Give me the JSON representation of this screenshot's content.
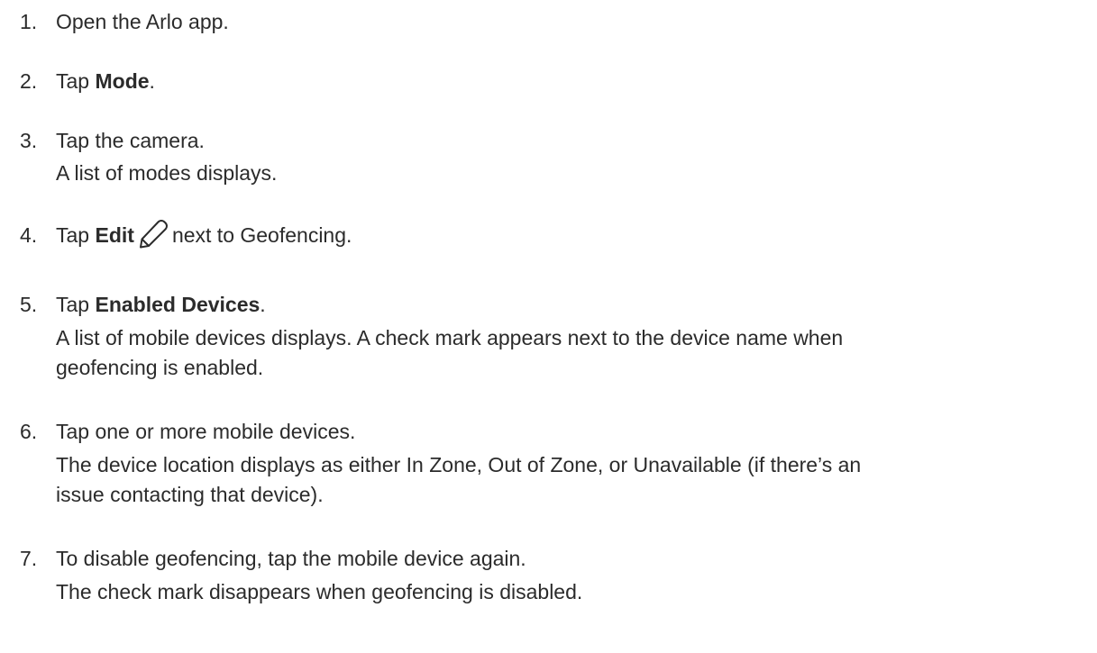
{
  "steps": [
    {
      "number": "1.",
      "main": {
        "before": "Open the Arlo app.",
        "bold": "",
        "after": ""
      },
      "details": []
    },
    {
      "number": "2.",
      "main": {
        "before": "Tap ",
        "bold": "Mode",
        "after": "."
      },
      "details": []
    },
    {
      "number": "3.",
      "main": {
        "before": "Tap the camera.",
        "bold": "",
        "after": ""
      },
      "details": [
        "A list of modes displays."
      ]
    },
    {
      "number": "4.",
      "main": {
        "before": "Tap ",
        "bold": "Edit",
        "after": "next to Geofencing."
      },
      "icon": "pencil-icon",
      "details": []
    },
    {
      "number": "5.",
      "main": {
        "before": "Tap ",
        "bold": "Enabled Devices",
        "after": "."
      },
      "details": [
        "A list of mobile devices displays. A check mark appears next to the device name when",
        "geofencing is enabled."
      ]
    },
    {
      "number": "6.",
      "main": {
        "before": "Tap one or more mobile devices.",
        "bold": "",
        "after": ""
      },
      "details": [
        "The device location displays as either In Zone, Out of Zone, or Unavailable (if there’s an",
        "issue contacting that device)."
      ]
    },
    {
      "number": "7.",
      "main": {
        "before": "To disable geofencing, tap the mobile device again.",
        "bold": "",
        "after": ""
      },
      "details": [
        "The check mark disappears when geofencing is disabled."
      ]
    }
  ]
}
